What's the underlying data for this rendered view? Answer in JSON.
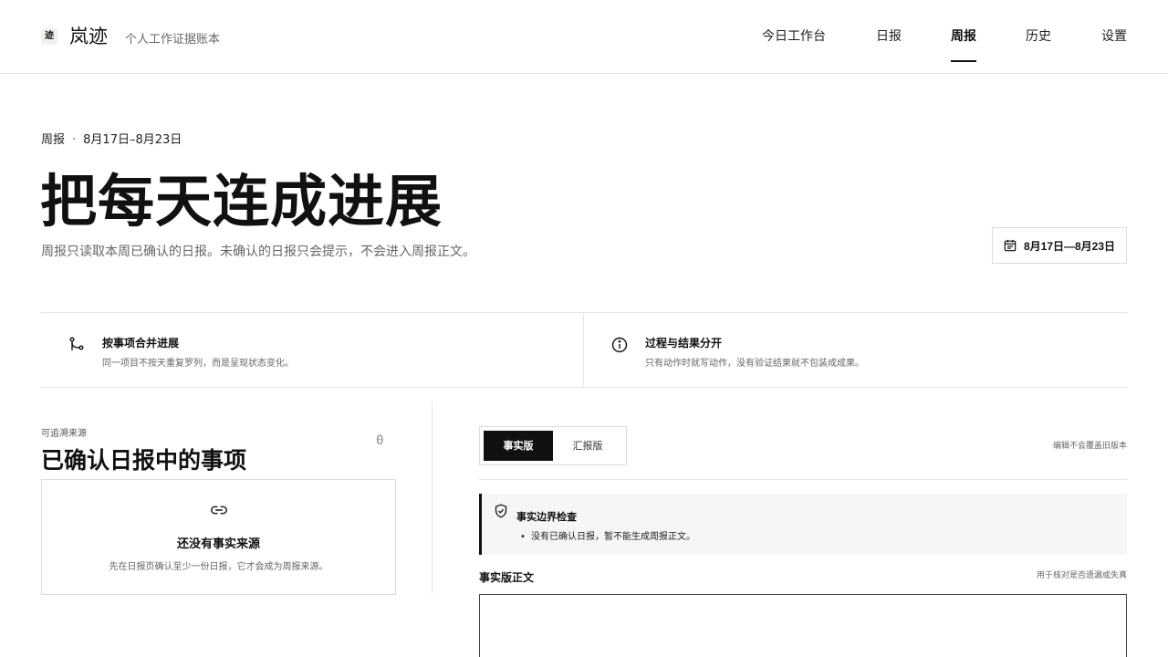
{
  "header": {
    "logo_glyph": "迹",
    "brand": "岚迹",
    "tagline": "个人工作证据账本",
    "nav": [
      {
        "label": "今日工作台",
        "active": false
      },
      {
        "label": "日报",
        "active": false
      },
      {
        "label": "周报",
        "active": true
      },
      {
        "label": "历史",
        "active": false
      },
      {
        "label": "设置",
        "active": false
      }
    ]
  },
  "hero": {
    "section": "周报",
    "date_range": "8月17日–8月23日",
    "title": "把每天连成进展",
    "subtitle": "周报只读取本周已确认的日报。未确认的日报只会提示，不会进入周报正文。",
    "date_button": "8月17日—8月23日"
  },
  "principles": [
    {
      "icon": "git-merge-icon",
      "title": "按事项合并进展",
      "desc": "同一项目不按天重复罗列，而是呈现状态变化。"
    },
    {
      "icon": "info-icon",
      "title": "过程与结果分开",
      "desc": "只有动作时就写动作，没有验证结果就不包装成成果。"
    }
  ],
  "sources": {
    "label": "可追溯来源",
    "title": "已确认日报中的事项",
    "count": "0",
    "empty_icon": "link-icon",
    "empty_title": "还没有事实来源",
    "empty_desc": "先在日报页确认至少一份日报，它才会成为周报来源。"
  },
  "editor": {
    "tabs": [
      {
        "label": "事实版",
        "active": true
      },
      {
        "label": "汇报版",
        "active": false
      }
    ],
    "edit_note": "编辑不会覆盖旧版本",
    "check": {
      "icon": "shield-check-icon",
      "title": "事实边界检查",
      "items": [
        "没有已确认日报，暂不能生成周报正文。"
      ]
    },
    "body_label": "事实版正文",
    "body_note": "用于核对是否遗漏或失真",
    "body_value": ""
  },
  "colors": {
    "text": "#111111",
    "muted": "#666666",
    "border": "#dcdcdc",
    "active_tab_bg": "#111111",
    "check_bg": "#f6f6f6"
  }
}
